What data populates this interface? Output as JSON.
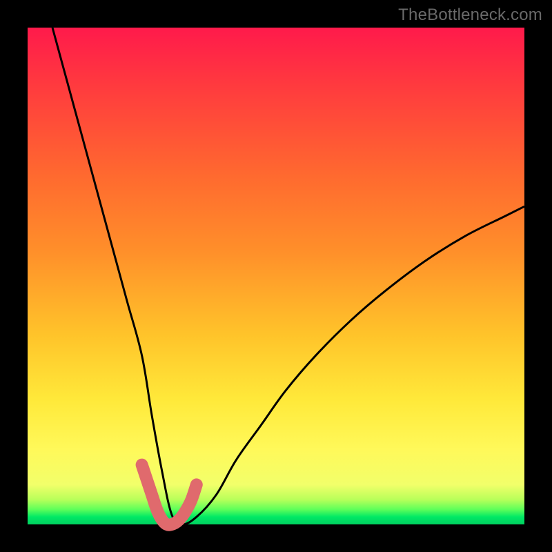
{
  "watermark": "TheBottleneck.com",
  "chart_data": {
    "type": "line",
    "title": "",
    "xlabel": "",
    "ylabel": "",
    "xlim": [
      0,
      100
    ],
    "ylim": [
      0,
      100
    ],
    "series": [
      {
        "name": "bottleneck-curve",
        "x": [
          5,
          8,
          11,
          14,
          17,
          20,
          23,
          25,
          27,
          29,
          31,
          34,
          38,
          42,
          47,
          52,
          58,
          65,
          72,
          80,
          88,
          96,
          100
        ],
        "y": [
          100,
          89,
          78,
          67,
          56,
          45,
          34,
          22,
          11,
          2,
          0,
          1.5,
          6,
          13,
          20,
          27,
          34,
          41,
          47,
          53,
          58,
          62,
          64
        ]
      },
      {
        "name": "highlight-band",
        "x": [
          23,
          24,
          25,
          26,
          27,
          28,
          29,
          30,
          31,
          32,
          33,
          34
        ],
        "y": [
          12,
          9,
          6,
          3,
          1,
          0,
          0,
          0.5,
          1.5,
          3,
          5,
          8
        ]
      }
    ],
    "colors": {
      "curve": "#000000",
      "highlight": "#e06a6d",
      "gradient_top": "#ff1a4b",
      "gradient_mid": "#ffe93a",
      "gradient_bottom": "#00d060"
    }
  }
}
